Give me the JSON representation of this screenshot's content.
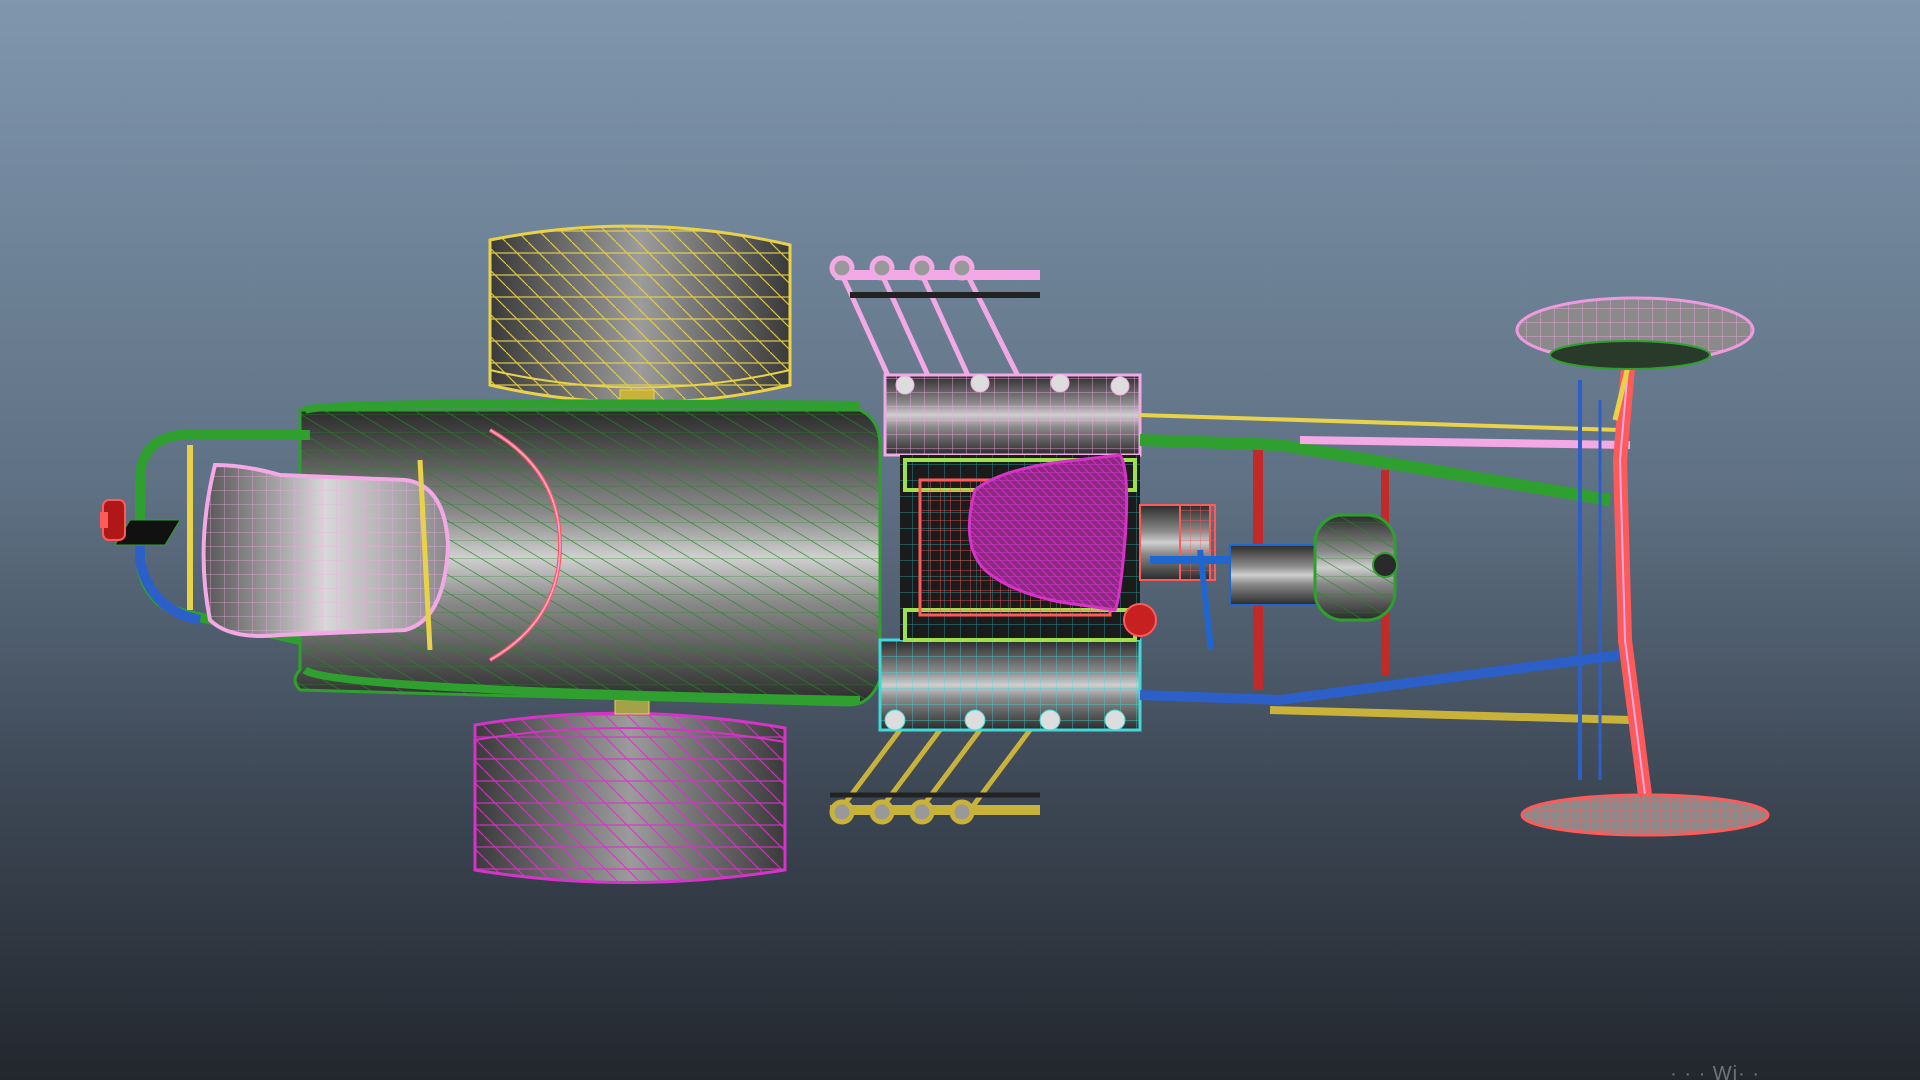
{
  "app": {
    "title": ""
  },
  "viewport": {
    "name": "3d-viewport",
    "display_mode": "wireframe-on-shaded",
    "view": "top",
    "background_top": "#7f96ad",
    "background_bottom": "#22272e"
  },
  "model": {
    "name": "hot-rod-dragster",
    "parts": [
      {
        "name": "rear-tire-top",
        "color": "#e8d24a"
      },
      {
        "name": "rear-tire-bottom",
        "color": "#d633c8"
      },
      {
        "name": "front-wheel-top",
        "color": "#ee9adf"
      },
      {
        "name": "front-wheel-bottom",
        "color": "#ff5a5a"
      },
      {
        "name": "seat",
        "color": "#f3a9e6"
      },
      {
        "name": "body-shell",
        "color": "#2fa02f"
      },
      {
        "name": "engine-block",
        "color": "#ff5a5a"
      },
      {
        "name": "air-scoop",
        "color": "#d633c8"
      },
      {
        "name": "exhaust-headers-top",
        "color": "#f3a9e6"
      },
      {
        "name": "exhaust-headers-bottom",
        "color": "#c9b23a"
      },
      {
        "name": "cylinder-heads",
        "color": "#40d8d8"
      },
      {
        "name": "chassis-rail-top",
        "color": "#2fa02f"
      },
      {
        "name": "chassis-rail-bottom",
        "color": "#2d5fc8"
      },
      {
        "name": "front-axle",
        "color": "#ff5a5a"
      },
      {
        "name": "fuel-tank",
        "color": "#2fa02f"
      },
      {
        "name": "tail-light",
        "color": "#cc2020"
      }
    ]
  },
  "overlay": {
    "watermark": "· · ·  Wi· ·"
  }
}
